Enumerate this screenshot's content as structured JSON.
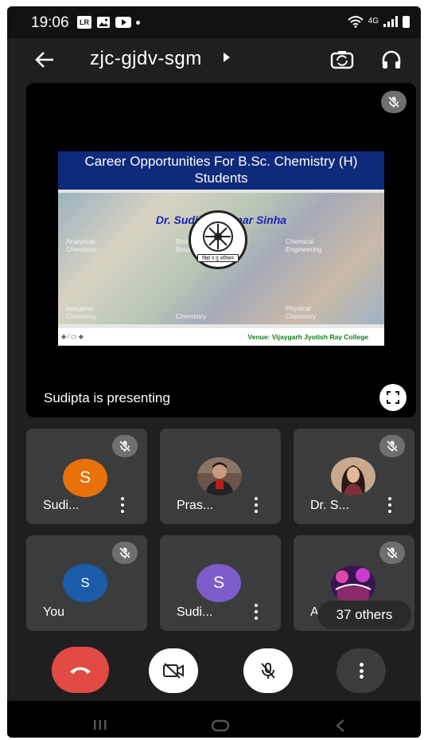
{
  "status_bar": {
    "time": "19:06",
    "network_label": "4G",
    "icons": [
      "lr-badge-icon",
      "photo-icon",
      "youtube-icon",
      "dot-icon",
      "wifi-icon",
      "signal-icon",
      "battery-icon"
    ]
  },
  "header": {
    "meeting_code": "zjc-gjdv-sgm",
    "icons": [
      "back-arrow-icon",
      "caret-right-icon",
      "switch-camera-icon",
      "headphones-icon"
    ]
  },
  "presentation": {
    "slide": {
      "title": "Career Opportunities For B.Sc. Chemistry (H) Students",
      "author": "Dr. Sudipta Kumar Sinha",
      "topics": [
        "Analytical Chemistry",
        "Biological/ Biochemistry",
        "Chemical Engineering",
        "Inorganic Chemistry",
        "Chemistry",
        "Physical Chemistry"
      ],
      "emblem_motto": "विद्या न तु अतिक्रम",
      "footer_venue": "Venue: Vijaygarh Jyotish Ray College",
      "footer_nav": "◆ ⁄ ▭ ◆"
    },
    "presenting_label": "Sudipta is presenting"
  },
  "participants": [
    {
      "name": "Sudi...",
      "avatar_letter": "S",
      "avatar_color": "#e8710a",
      "muted": true,
      "has_menu": true
    },
    {
      "name": "Pras...",
      "avatar_letter": "",
      "avatar_color": "",
      "muted": false,
      "has_menu": true
    },
    {
      "name": "Dr. S...",
      "avatar_letter": "",
      "avatar_color": "",
      "muted": true,
      "has_menu": true
    },
    {
      "name": "You",
      "avatar_letter": "S",
      "avatar_color": "#1a5ca8",
      "muted": true,
      "has_menu": false
    },
    {
      "name": "Sudi...",
      "avatar_letter": "S",
      "avatar_color": "#7c5cc9",
      "muted": false,
      "has_menu": true
    },
    {
      "name": "A",
      "avatar_letter": "",
      "avatar_color": "",
      "muted": true,
      "has_menu": false
    }
  ],
  "others_label": "37 others",
  "controls": {
    "end_call_color": "#e24a43",
    "icons": [
      "phone-hangup-icon",
      "camera-off-icon",
      "mic-off-icon",
      "more-vertical-icon"
    ]
  },
  "colors": {
    "background": "#1f1f1f",
    "tile": "#3b3c3e",
    "slide_header": "#0e2a7a",
    "author_text": "#1a23b8",
    "venue_text": "#117a1a"
  }
}
